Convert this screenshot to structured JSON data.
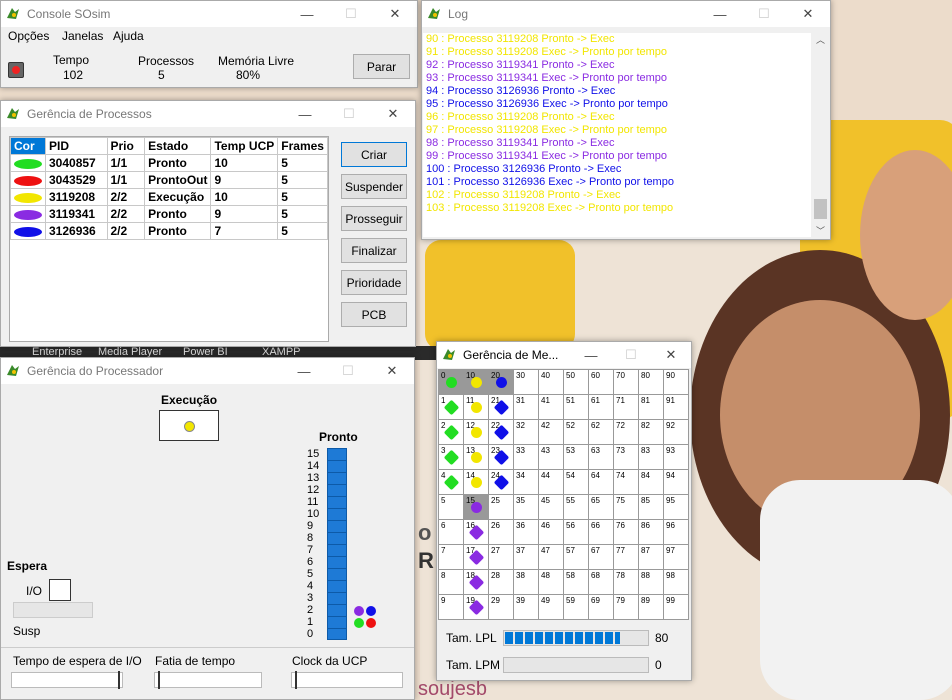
{
  "colors": {
    "green": "#22dd22",
    "red": "#ee1111",
    "yellow": "#f2e600",
    "purple": "#8a2be2",
    "blue": "#1010e8",
    "accent": "#0078d7"
  },
  "background": {
    "labels": [
      "Enterprise",
      "Media Player",
      "Power BI",
      "XAMPP"
    ],
    "text": "soujesb"
  },
  "console": {
    "title": "Console SOsim",
    "menu": [
      "Opções",
      "Janelas",
      "Ajuda"
    ],
    "tempo_label": "Tempo",
    "tempo_value": "102",
    "proc_label": "Processos",
    "proc_value": "5",
    "mem_label": "Memória Livre",
    "mem_value": "80%",
    "stop_button": "Parar"
  },
  "log": {
    "title": "Log",
    "lines": [
      {
        "text": "90 : Processo 3119208 Pronto -> Exec",
        "color": "yellow"
      },
      {
        "text": "91 : Processo 3119208 Exec -> Pronto por tempo",
        "color": "yellow"
      },
      {
        "text": "92 : Processo 3119341 Pronto -> Exec",
        "color": "purple"
      },
      {
        "text": "93 : Processo 3119341 Exec -> Pronto por tempo",
        "color": "purple"
      },
      {
        "text": "94 : Processo 3126936 Pronto -> Exec",
        "color": "blue"
      },
      {
        "text": "95 : Processo 3126936 Exec -> Pronto por tempo",
        "color": "blue"
      },
      {
        "text": "96 : Processo 3119208 Pronto -> Exec",
        "color": "yellow"
      },
      {
        "text": "97 : Processo 3119208 Exec -> Pronto por tempo",
        "color": "yellow"
      },
      {
        "text": "98 : Processo 3119341 Pronto -> Exec",
        "color": "purple"
      },
      {
        "text": "99 : Processo 3119341 Exec -> Pronto por tempo",
        "color": "purple"
      },
      {
        "text": "100 : Processo 3126936 Pronto -> Exec",
        "color": "blue"
      },
      {
        "text": "101 : Processo 3126936 Exec -> Pronto por tempo",
        "color": "blue"
      },
      {
        "text": "102 : Processo 3119208 Pronto -> Exec",
        "color": "yellow"
      },
      {
        "text": "103 : Processo 3119208 Exec -> Pronto por tempo",
        "color": "yellow"
      }
    ]
  },
  "procs": {
    "title": "Gerência de Processos",
    "headers": [
      "Cor",
      "PID",
      "Prio",
      "Estado",
      "Temp UCP",
      "Frames"
    ],
    "rows": [
      {
        "color": "green",
        "pid": "3040857",
        "prio": "1/1",
        "estado": "Pronto",
        "temp": "10",
        "frames": "5"
      },
      {
        "color": "red",
        "pid": "3043529",
        "prio": "1/1",
        "estado": "ProntoOut",
        "temp": "9",
        "frames": "5"
      },
      {
        "color": "yellow",
        "pid": "3119208",
        "prio": "2/2",
        "estado": "Execução",
        "temp": "10",
        "frames": "5"
      },
      {
        "color": "purple",
        "pid": "3119341",
        "prio": "2/2",
        "estado": "Pronto",
        "temp": "9",
        "frames": "5"
      },
      {
        "color": "blue",
        "pid": "3126936",
        "prio": "2/2",
        "estado": "Pronto",
        "temp": "7",
        "frames": "5"
      }
    ],
    "buttons": [
      "Criar",
      "Suspender",
      "Prosseguir",
      "Finalizar",
      "Prioridade",
      "PCB"
    ]
  },
  "cpu": {
    "title": "Gerência do Processador",
    "exec_label": "Execução",
    "ready_label": "Pronto",
    "wait_label": "Espera",
    "io_label": "I/O",
    "susp_label": "Susp",
    "queue_numbers": [
      "15",
      "14",
      "13",
      "12",
      "11",
      "10",
      "9",
      "8",
      "7",
      "6",
      "5",
      "4",
      "3",
      "2",
      "1",
      "0"
    ],
    "slider1": "Tempo de espera de I/O",
    "slider2": "Fatia de tempo",
    "slider3": "Clock da UCP"
  },
  "mem": {
    "title": "Gerência de Me...",
    "lpl_label": "Tam. LPL",
    "lpl_value": "80",
    "lpl_fill": 0.8,
    "lpm_label": "Tam. LPM",
    "lpm_value": "0",
    "lpm_fill": 0,
    "frames": {
      "0": "green",
      "1": "green",
      "2": "green",
      "3": "green",
      "4": "green",
      "10": "yellow",
      "11": "yellow",
      "12": "yellow",
      "13": "yellow",
      "14": "yellow",
      "15": "purple",
      "16": "purple",
      "17": "purple",
      "18": "purple",
      "19": "purple",
      "20": "blue",
      "21": "blue",
      "22": "blue",
      "23": "blue",
      "24": "blue"
    },
    "highlight": [
      "0",
      "10",
      "20",
      "15"
    ]
  }
}
